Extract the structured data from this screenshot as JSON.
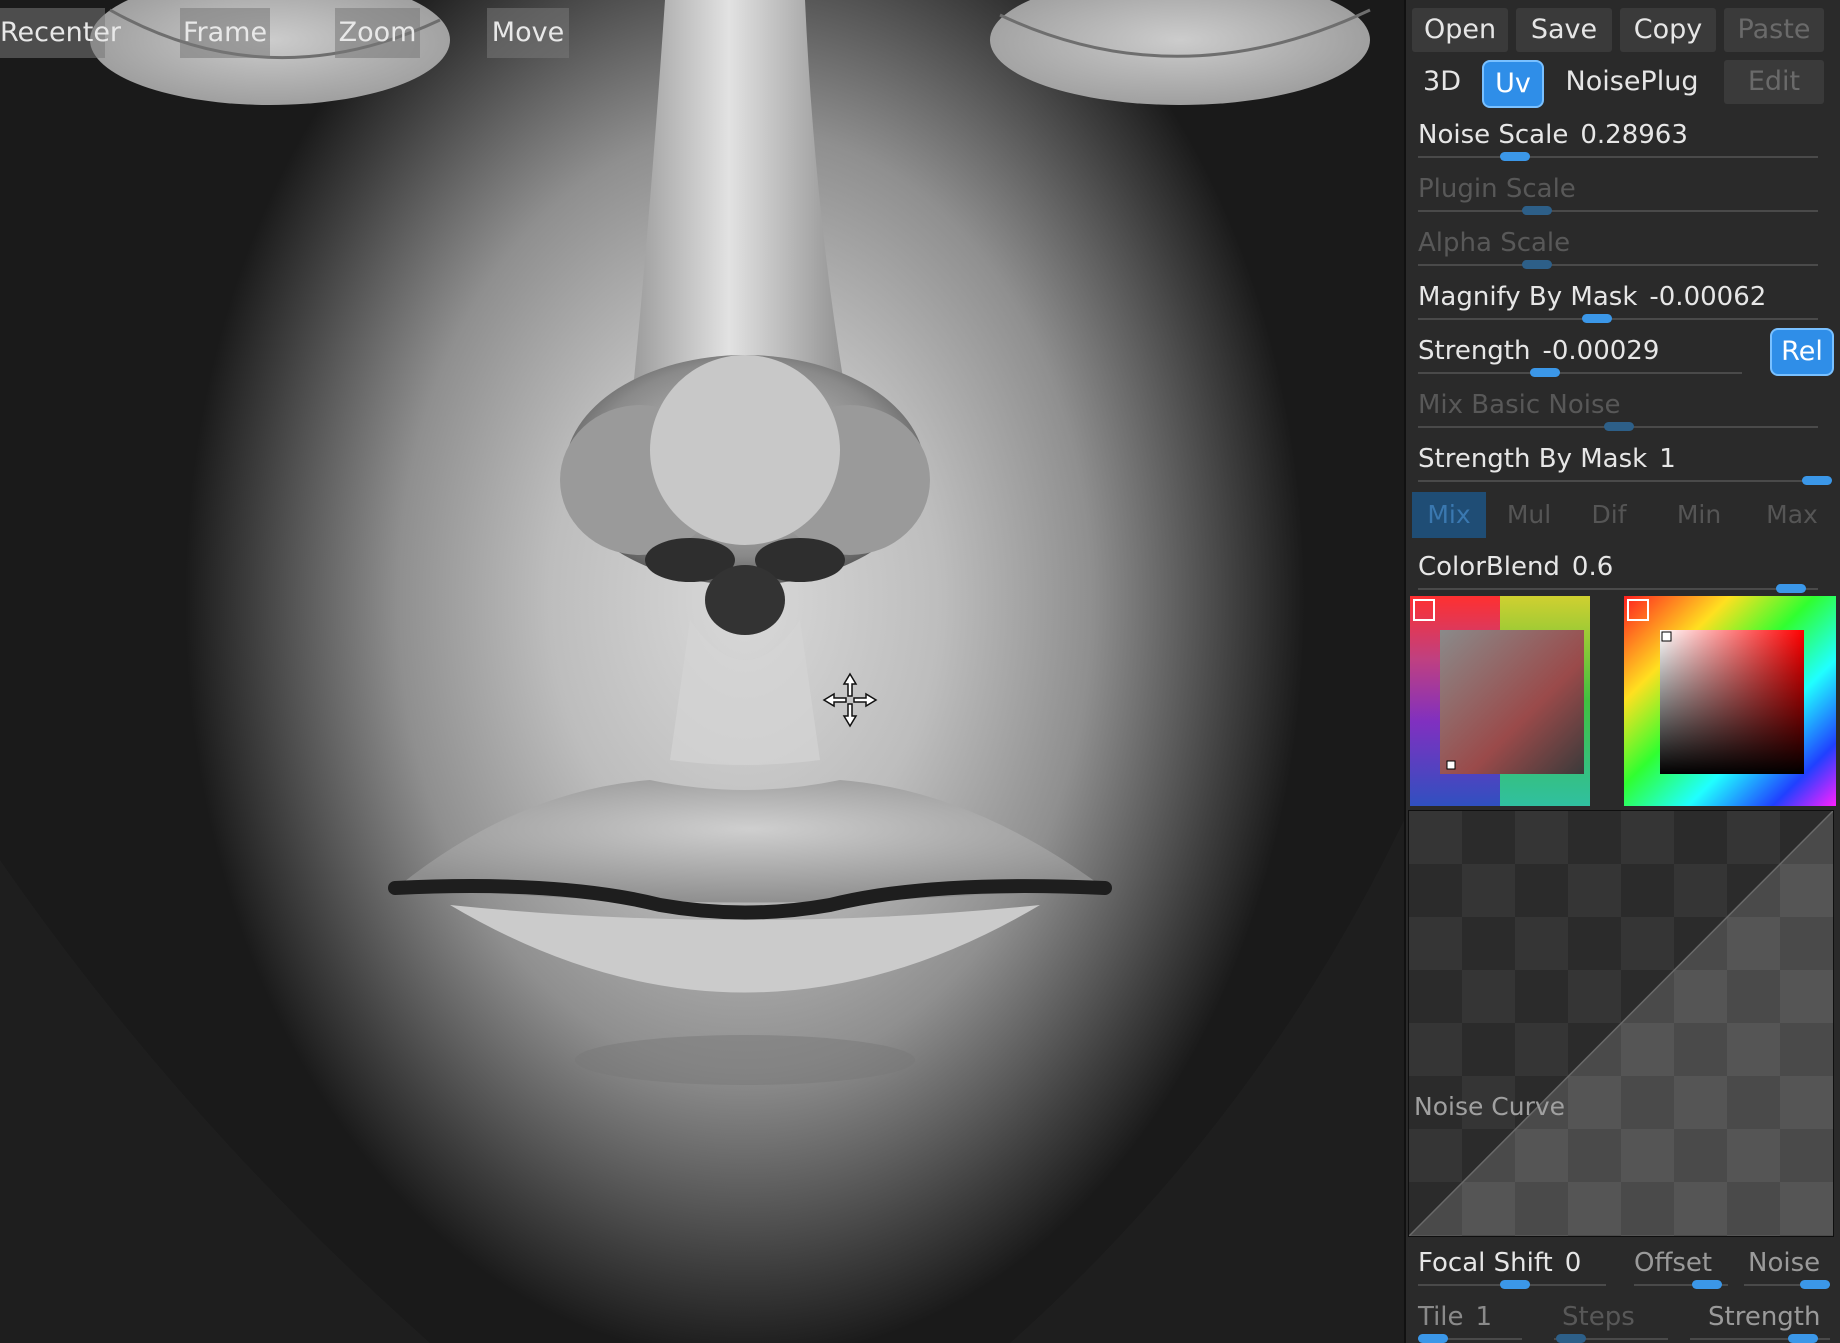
{
  "viewport": {
    "buttons": [
      "Recenter",
      "Frame",
      "Zoom",
      "Move"
    ]
  },
  "panel": {
    "top_buttons": [
      "Open",
      "Save",
      "Copy",
      "Paste"
    ],
    "mode_buttons": [
      "3D",
      "Uv",
      "NoisePlug",
      "Edit"
    ],
    "sliders": {
      "noise_scale": {
        "label": "Noise Scale",
        "value": "0.28963"
      },
      "plugin_scale": {
        "label": "Plugin Scale",
        "value": ""
      },
      "alpha_scale": {
        "label": "Alpha Scale",
        "value": ""
      },
      "magnify_by_mask": {
        "label": "Magnify By Mask",
        "value": "-0.00062"
      },
      "strength": {
        "label": "Strength",
        "value": "-0.00029"
      },
      "mix_basic_noise": {
        "label": "Mix Basic Noise",
        "value": ""
      },
      "strength_by_mask": {
        "label": "Strength By Mask",
        "value": "1"
      },
      "color_blend": {
        "label": "ColorBlend",
        "value": "0.6"
      }
    },
    "rel_button": "Rel",
    "blend_modes": [
      "Mix",
      "Mul",
      "Dif",
      "Min",
      "Max"
    ],
    "selected_blend_mode": "Mix",
    "curve_label": "Noise Curve",
    "bottom_row1": {
      "focal_shift": "Focal Shift",
      "focal_shift_value": "0",
      "offset": "Offset",
      "noise": "Noise"
    },
    "bottom_row2": {
      "tile": "Tile",
      "tile_value": "1",
      "steps": "Steps",
      "strength": "Strength"
    }
  },
  "colors": {
    "accent": "#2f8ee8",
    "panel_bg": "#2a2a2a",
    "slider_knob": "#3b97e8"
  }
}
